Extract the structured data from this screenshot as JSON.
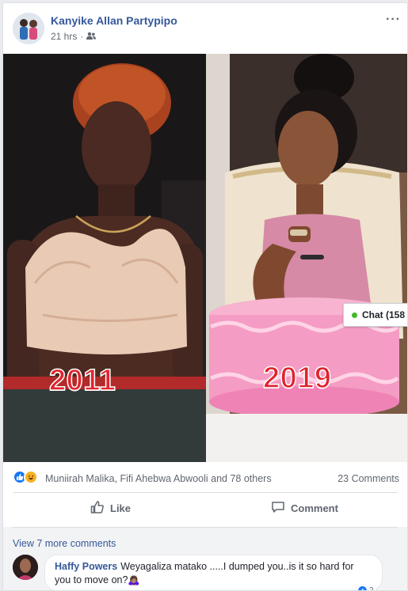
{
  "post": {
    "author": "Kanyike Allan Partypipo",
    "time": "21 hrs",
    "privacy_icon": "friends-icon",
    "menu_icon": "more-options-icon"
  },
  "photo": {
    "left_year": "2011",
    "right_year": "2019"
  },
  "chat_widget": {
    "label": "Chat (158",
    "status_color": "#42b72a"
  },
  "reactions": {
    "icons": [
      "like-icon",
      "haha-icon"
    ],
    "names": "Muniirah Malika, Fifi Ahebwa Abwooli and 78 others",
    "comments_count": "23 Comments"
  },
  "actions": {
    "like_label": "Like",
    "comment_label": "Comment"
  },
  "comments": {
    "view_more": "View 7 more comments",
    "items": [
      {
        "author": "Haffy Powers",
        "text": "Weyagaliza matako .....I dumped you..is it so hard for you to move on?",
        "emoji": "🙇🏽‍♀️",
        "likes": "2"
      }
    ]
  },
  "colors": {
    "link": "#365899",
    "like_blue": "#1877f2",
    "year_red": "#e0242d"
  }
}
